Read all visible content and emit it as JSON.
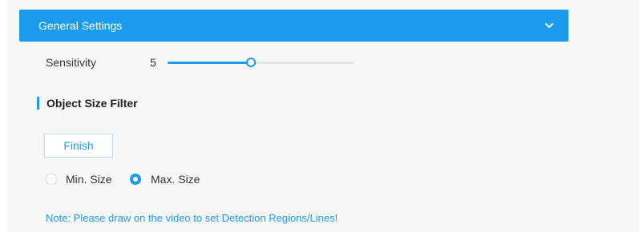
{
  "header": {
    "title": "General Settings",
    "toggle_icon": "chevron-down-icon"
  },
  "sensitivity": {
    "label": "Sensitivity",
    "value": "5",
    "slider_fraction": 0.45
  },
  "object_size_filter": {
    "section_title": "Object Size Filter",
    "finish_label": "Finish",
    "options": [
      {
        "label": "Min. Size",
        "selected": false
      },
      {
        "label": "Max. Size",
        "selected": true
      }
    ]
  },
  "note": "Note: Please draw on the video to set Detection Regions/Lines!",
  "colors": {
    "accent": "#1a9bec",
    "panel_bg": "#f7f7f7",
    "track": "#e4e4e4"
  }
}
